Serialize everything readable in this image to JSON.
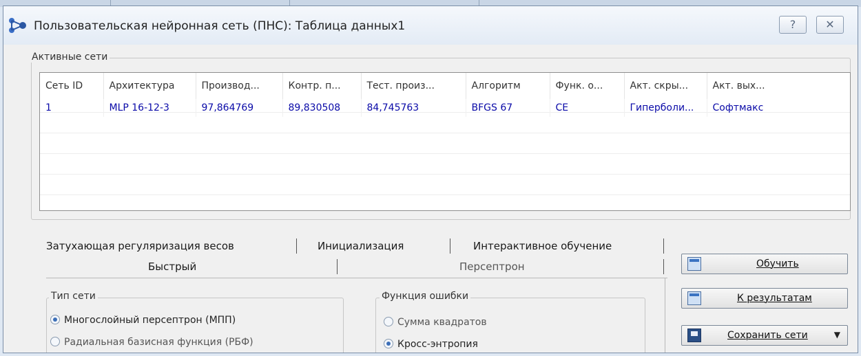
{
  "window": {
    "title": "Пользовательская нейронная сеть (ПНС): Таблица данных1",
    "help_label": "?",
    "close_label": "✕"
  },
  "active_networks": {
    "label": "Активные сети",
    "columns": [
      "Сеть ID",
      "Архитектура",
      "Производ...",
      "Контр. п...",
      "Тест. произ...",
      "Алгоритм",
      "Функ. о...",
      "Акт. скры...",
      "Акт. вых..."
    ],
    "rows": [
      [
        "1",
        "MLP 16-12-3",
        "97,864769",
        "89,830508",
        "84,745763",
        "BFGS 67",
        "CE",
        "Гиперболи...",
        "Софтмакс"
      ]
    ]
  },
  "tabs": {
    "row1": [
      "Затухающая регуляризация весов",
      "Инициализация",
      "Интерактивное обучение"
    ],
    "row2": [
      "Быстрый",
      "Персептрон"
    ]
  },
  "network_type": {
    "label": "Тип сети",
    "options": [
      "Многослойный персептрон (МПП)",
      "Радиальная базисная функция (РБФ)"
    ],
    "selected": 0
  },
  "error_function": {
    "label": "Функция ошибки",
    "options": [
      "Сумма квадратов",
      "Кросс-энтропия"
    ],
    "selected": 1
  },
  "buttons": {
    "train": "Обучить",
    "to_results": "К результатам",
    "save_networks": "Сохранить сети",
    "save_arrow": "▼"
  }
}
